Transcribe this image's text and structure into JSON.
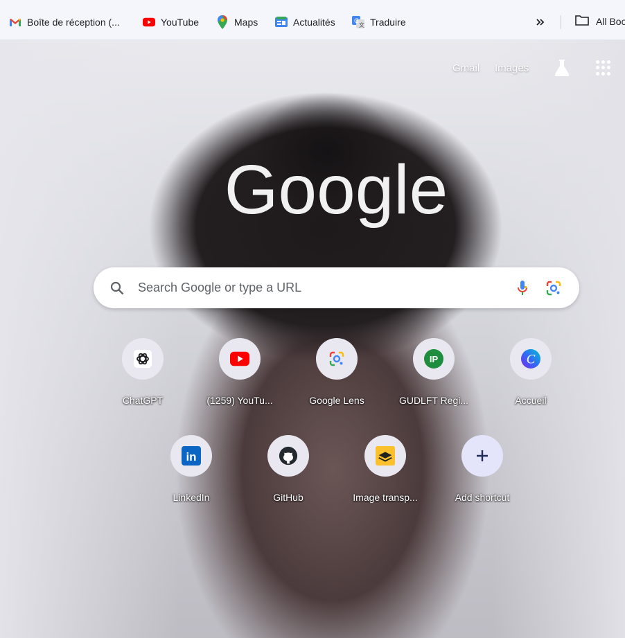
{
  "bookmarks_bar": {
    "items": [
      {
        "label": "Boîte de réception (...",
        "icon": "gmail-icon"
      },
      {
        "label": "YouTube",
        "icon": "youtube-icon"
      },
      {
        "label": "Maps",
        "icon": "maps-icon"
      },
      {
        "label": "Actualités",
        "icon": "news-icon"
      },
      {
        "label": "Traduire",
        "icon": "translate-icon"
      }
    ],
    "all_bookmarks_label": "All Boo"
  },
  "header": {
    "gmail_label": "Gmail",
    "images_label": "Images"
  },
  "logo_text": "Google",
  "search": {
    "placeholder": "Search Google or type a URL"
  },
  "shortcuts": [
    {
      "label": "ChatGPT",
      "icon": "chatgpt-icon"
    },
    {
      "label": "(1259) YouTu...",
      "icon": "youtube-icon"
    },
    {
      "label": "Google Lens",
      "icon": "google-lens-icon"
    },
    {
      "label": "GUDLFT Regi...",
      "icon": "ip-icon",
      "badge_text": "IP"
    },
    {
      "label": "Accueil",
      "icon": "canva-icon",
      "badge_text": "C"
    },
    {
      "label": "LinkedIn",
      "icon": "linkedin-icon",
      "badge_text": "in"
    },
    {
      "label": "GitHub",
      "icon": "github-icon"
    },
    {
      "label": "Image transp...",
      "icon": "image-transparency-icon"
    },
    {
      "label": "Add shortcut",
      "icon": "plus-icon"
    }
  ],
  "colors": {
    "google_blue": "#4285F4",
    "google_red": "#EA4335",
    "google_yellow": "#FBBC05",
    "google_green": "#34A853",
    "youtube_red": "#FF0000",
    "linkedin_blue": "#0A66C2",
    "ip_green": "#1E8E3E"
  }
}
